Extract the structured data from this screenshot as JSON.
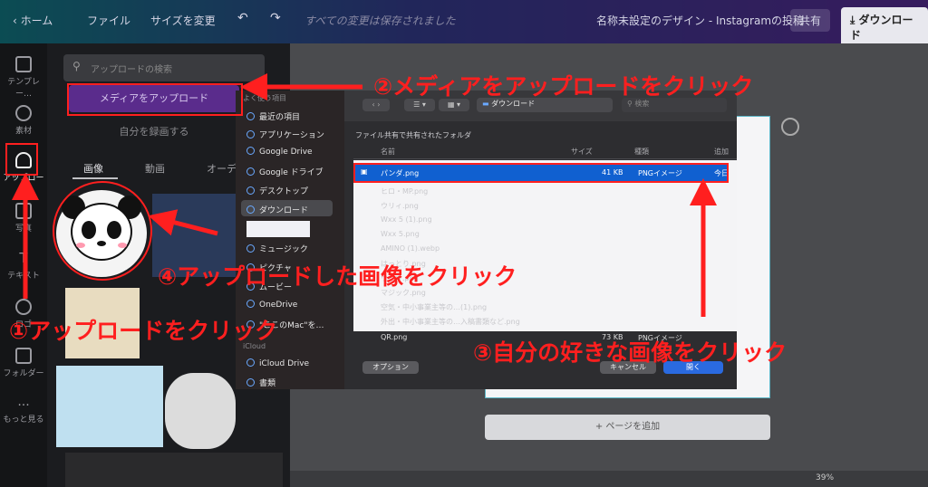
{
  "topbar": {
    "home": "ホーム",
    "file": "ファイル",
    "resize": "サイズを変更",
    "saved": "すべての変更は保存されました",
    "design_title": "名称未設定のデザイン - Instagramの投稿",
    "share": "共有",
    "download": "ダウンロード"
  },
  "rail": {
    "templates": "テンプレー…",
    "elements": "素材",
    "uploads": "アップロード",
    "photos": "写真",
    "text": "テキスト",
    "brand": "ロゴ",
    "folder": "フォルダー",
    "more": "もっと見る"
  },
  "panel": {
    "search_placeholder": "アップロードの検索",
    "upload_button": "メディアをアップロード",
    "record_button": "自分を録画する",
    "tabs": [
      "画像",
      "動画",
      "オーディオ"
    ]
  },
  "finder": {
    "sidebar_heading": "よく使う項目",
    "sidebar": [
      "最近の項目",
      "アプリケーション",
      "Google Drive",
      "Google ドライブ",
      "デスクトップ",
      "ダウンロード",
      "",
      "ミュージック",
      "ピクチャ",
      "ムービー",
      "OneDrive",
      "\"ここのMac\"を…"
    ],
    "icloud_heading": "iCloud",
    "icloud": [
      "iCloud Drive",
      "書類"
    ],
    "location": "ダウンロード",
    "search_placeholder": "検索",
    "shared_header": "ファイル共有で共有されたフォルダ",
    "columns": [
      "名前",
      "サイズ",
      "種類",
      "追加"
    ],
    "selected_row": {
      "name": "パンダ.png",
      "size": "41 KB",
      "kind": "PNGイメージ",
      "added": "今日"
    },
    "rows": [
      "ヒロ・MP.png",
      "ウリィ.png",
      "Wxx 5 (1).png",
      "Wxx 5.png",
      "AMINO (1).webp",
      "はっとり.png",
      "ウラウ.png",
      "マジック.png",
      "チーズ(デ…).png",
      "空気・中小事業主等の…(1).png",
      "外出・中小事業主等の…入稿書類など.png",
      "QR.png"
    ],
    "last_row": {
      "name": "QR.png",
      "size": "73 KB",
      "kind": "PNGイメージ"
    },
    "options": "オプション",
    "cancel": "キャンセル",
    "open": "開く"
  },
  "canvas": {
    "add_page": "+ ページを追加",
    "zoom": "39%"
  },
  "annotations": {
    "a1": "①アップロードをクリック",
    "a2": "②メディアをアップロードをクリック",
    "a3": "③自分の好きな画像をクリック",
    "a4": "④アップロードした画像をクリック"
  },
  "colors": {
    "annotation": "#ff1f1f",
    "upload_button": "#5a2c8c",
    "selection": "#1060d0"
  }
}
